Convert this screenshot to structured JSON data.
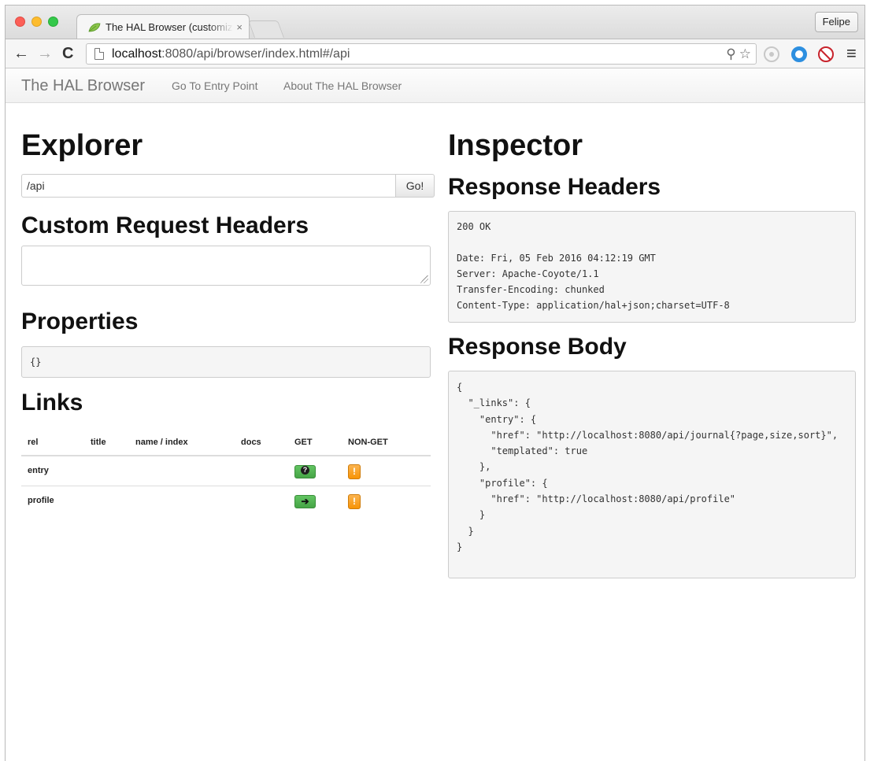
{
  "browser": {
    "tab_title": "The HAL Browser (customizable)",
    "tab_close": "×",
    "profile_name": "Felipe",
    "url_host": "localhost",
    "url_rest": ":8080/api/browser/index.html#/api",
    "icons": [
      "back-arrow-icon",
      "forward-arrow-icon",
      "reload-icon",
      "page-icon",
      "zoom-icon",
      "star-icon",
      "extension-icon",
      "extension-icon",
      "block-icon",
      "menu-icon"
    ]
  },
  "navbar": {
    "brand": "The HAL Browser",
    "links": [
      "Go To Entry Point",
      "About The HAL Browser"
    ]
  },
  "explorer": {
    "title": "Explorer",
    "url_value": "/api",
    "go_label": "Go!",
    "custom_headers_title": "Custom Request Headers",
    "custom_headers_value": "",
    "properties_title": "Properties",
    "properties_value": "{}",
    "links_title": "Links",
    "links_columns": [
      "rel",
      "title",
      "name / index",
      "docs",
      "GET",
      "NON-GET"
    ],
    "links_rows": [
      {
        "rel": "entry",
        "title": "",
        "name": "",
        "docs": "",
        "get_icon": "?",
        "nonget_icon": "!"
      },
      {
        "rel": "profile",
        "title": "",
        "name": "",
        "docs": "",
        "get_icon": "➔",
        "nonget_icon": "!"
      }
    ]
  },
  "inspector": {
    "title": "Inspector",
    "response_headers_title": "Response Headers",
    "response_headers": "200 OK\n\nDate: Fri, 05 Feb 2016 04:12:19 GMT\nServer: Apache-Coyote/1.1\nTransfer-Encoding: chunked\nContent-Type: application/hal+json;charset=UTF-8",
    "response_body_title": "Response Body",
    "response_body": "{\n  \"_links\": {\n    \"entry\": {\n      \"href\": \"http://localhost:8080/api/journal{?page,size,sort}\",\n      \"templated\": true\n    },\n    \"profile\": {\n      \"href\": \"http://localhost:8080/api/profile\"\n    }\n  }\n}"
  },
  "colors": {
    "get_button": "#46a546",
    "nonget_button": "#f89406",
    "pre_background": "#f5f5f5"
  }
}
